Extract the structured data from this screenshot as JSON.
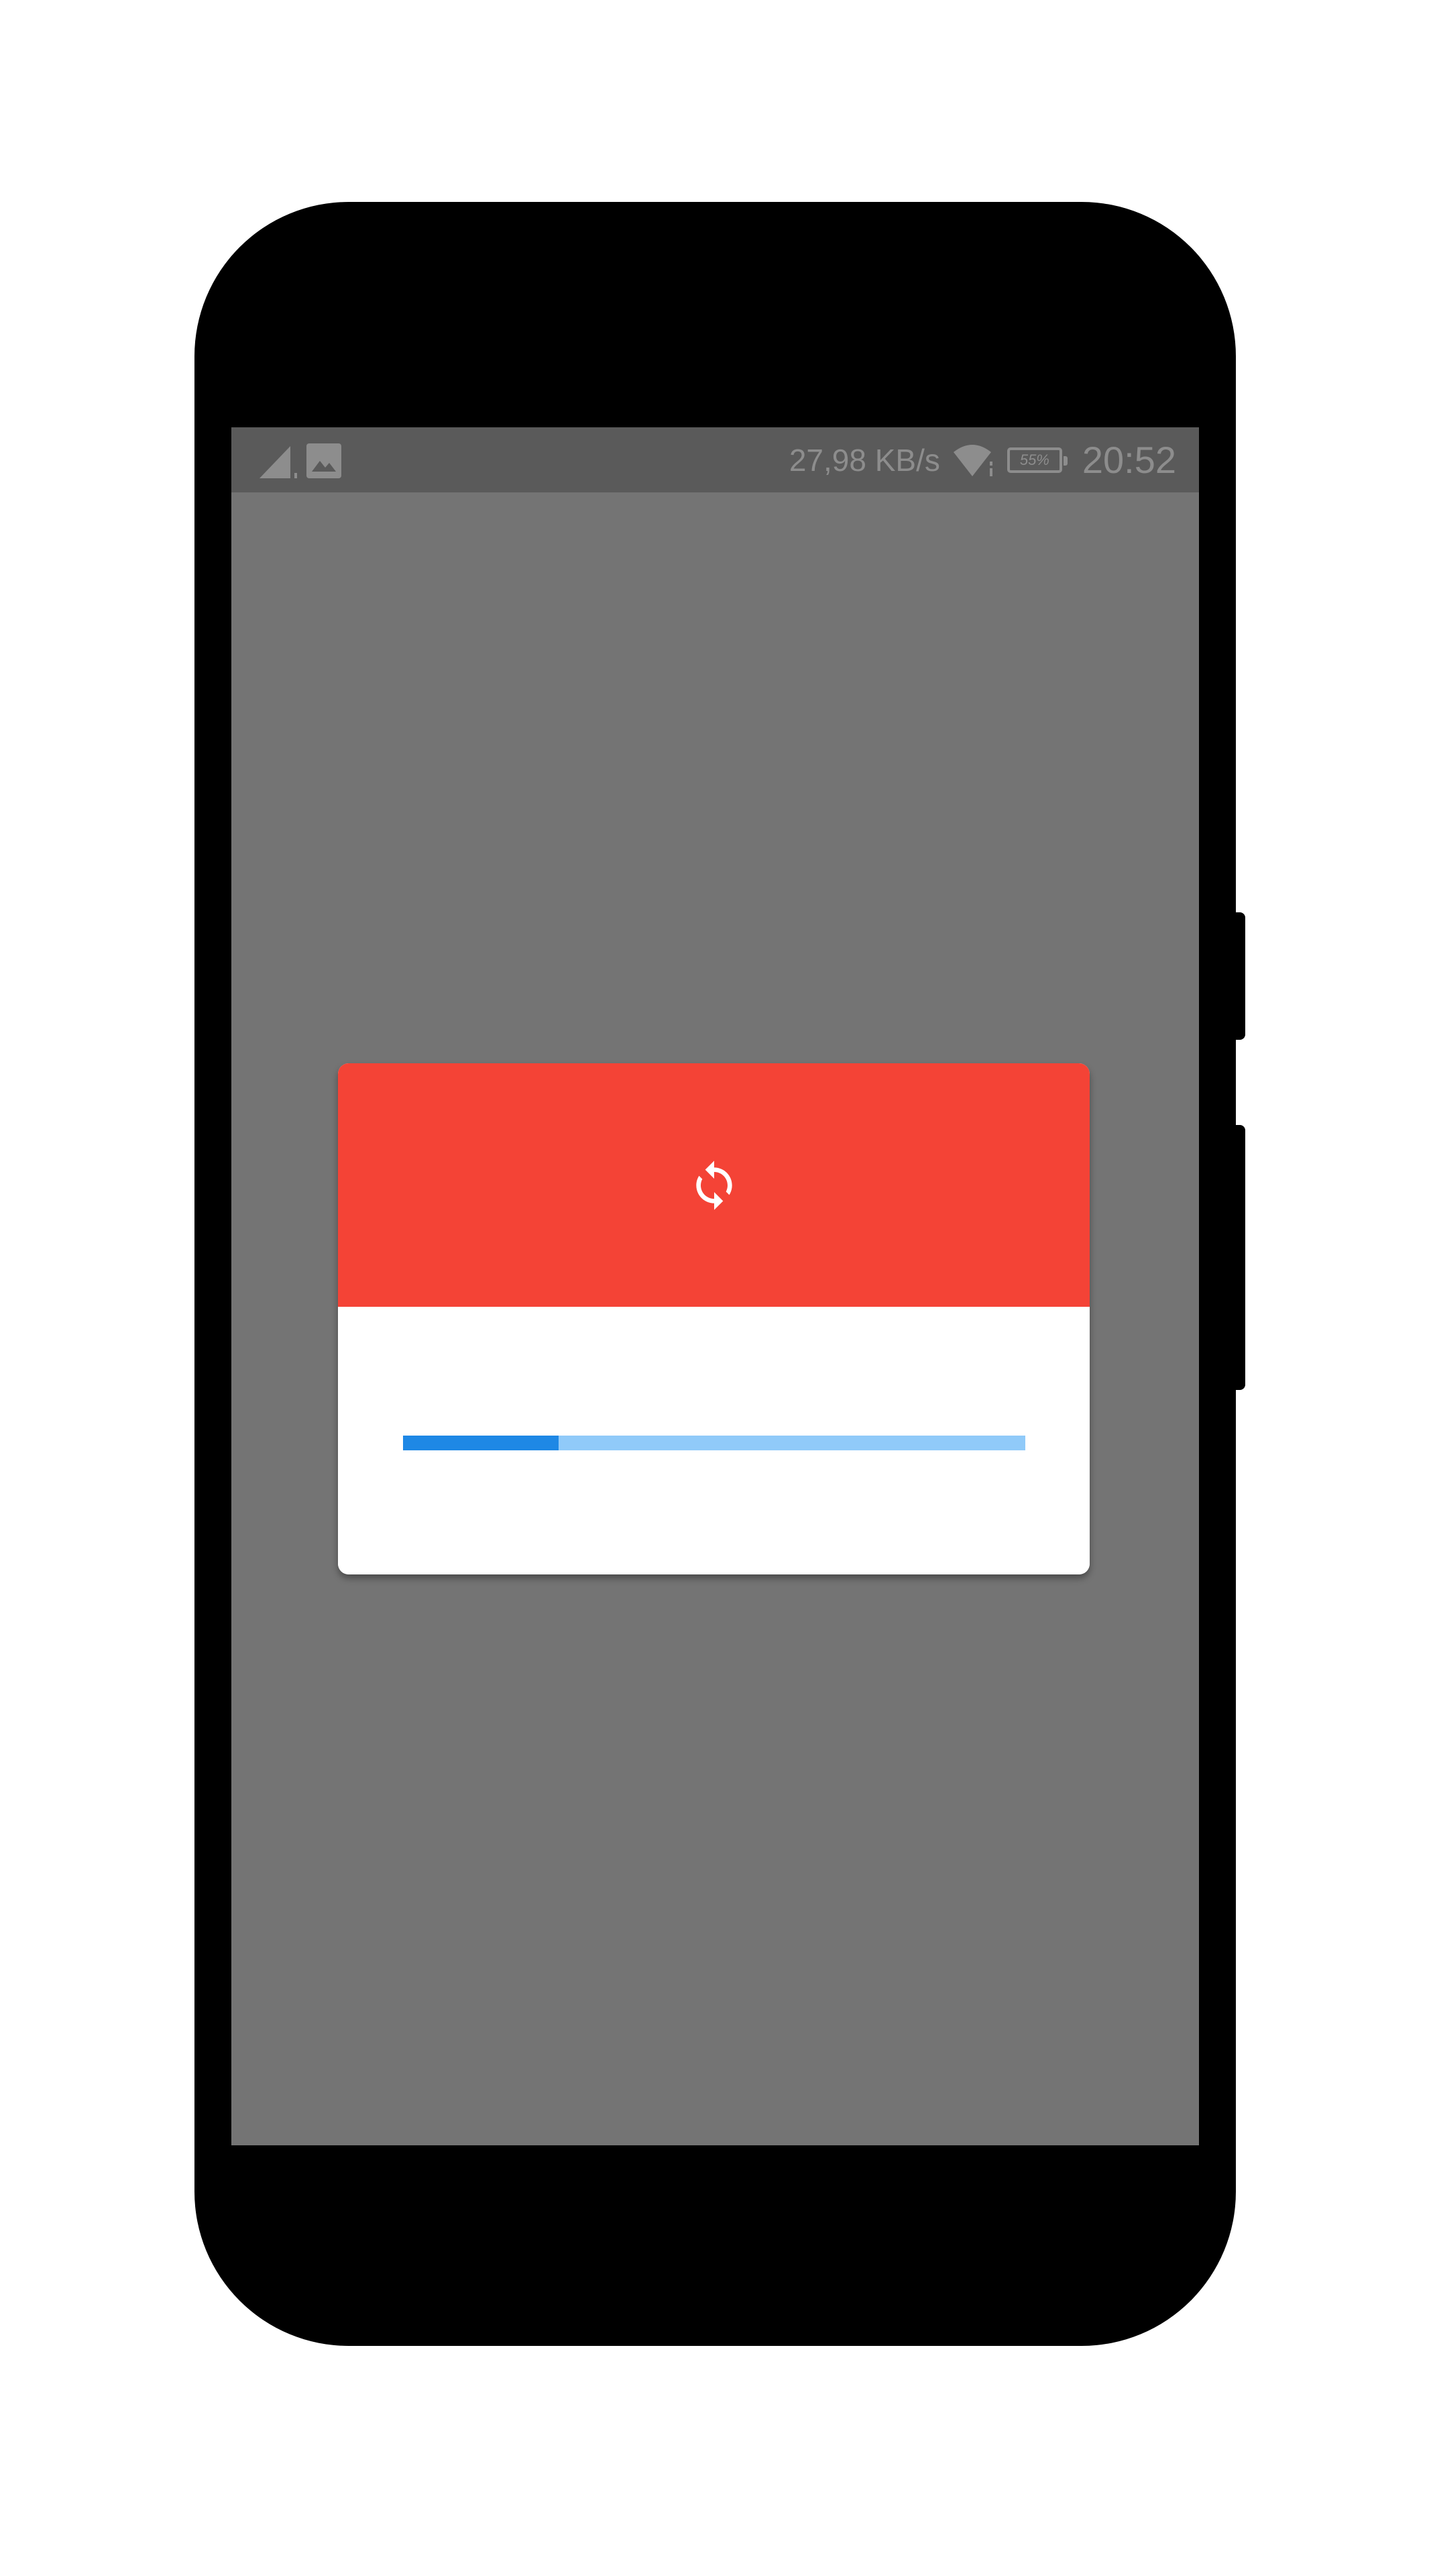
{
  "status_bar": {
    "network_speed": "27,98  KB/s",
    "battery_percent": "55%",
    "time": "20:52",
    "icons": [
      "signal-icon",
      "image-notification-icon",
      "wifi-icon",
      "battery-icon"
    ]
  },
  "dialog": {
    "header_color": "#f44336",
    "header_icon": "sync-icon",
    "progress": 0.25,
    "progress_color": "#1e88e5",
    "progress_track_color": "#90caf9"
  }
}
